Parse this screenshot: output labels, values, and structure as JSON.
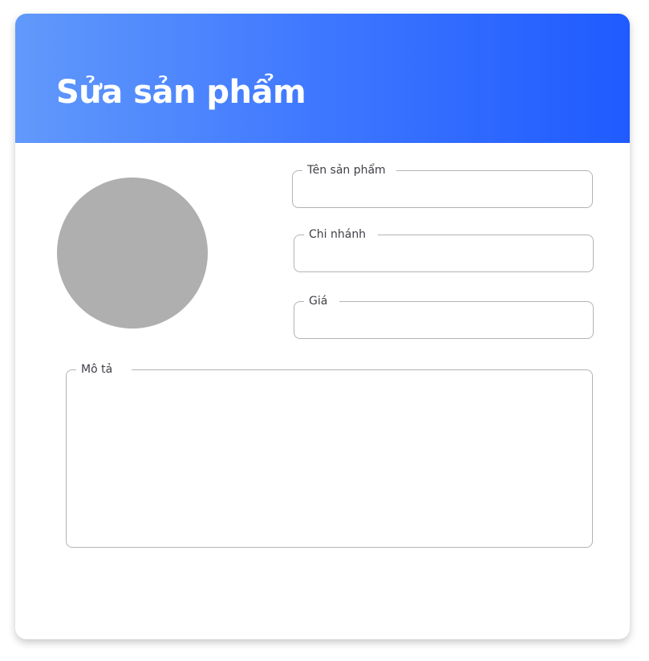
{
  "header": {
    "title": "Sửa sản phẩm",
    "gradient_start": "#6199fb",
    "gradient_end": "#1f5bff"
  },
  "avatar": {
    "color": "#afafaf"
  },
  "form": {
    "name": {
      "label": "Tên sản phẩm",
      "value": ""
    },
    "branch": {
      "label": "Chi nhánh",
      "value": ""
    },
    "price": {
      "label": "Giá",
      "value": ""
    },
    "description": {
      "label": "Mô tả",
      "value": ""
    }
  }
}
